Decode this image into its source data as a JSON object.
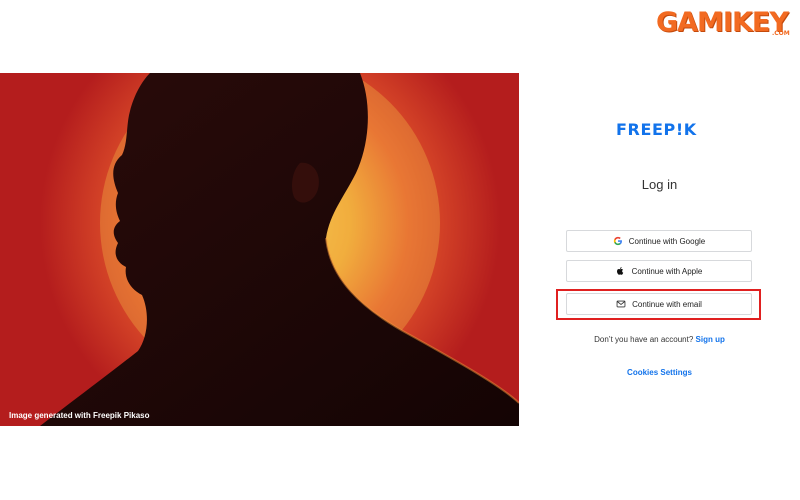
{
  "watermark": {
    "brand": "GAMIKEY",
    "suffix": ".COM"
  },
  "hero": {
    "caption": "Image generated with Freepik Pikaso",
    "colors": {
      "background": "#c0221f",
      "sun_core": "#f5c84a",
      "silhouette": "#1a0707"
    }
  },
  "login": {
    "logo": "FREEP!K",
    "title": "Log in",
    "buttons": {
      "google": {
        "label": "Continue with Google",
        "icon": "google-icon"
      },
      "apple": {
        "label": "Continue with Apple",
        "icon": "apple-icon"
      },
      "email": {
        "label": "Continue with email",
        "icon": "mail-icon"
      }
    },
    "no_account_text": "Don’t you have an account?",
    "signup_link": "Sign up",
    "cookies_link": "Cookies Settings"
  },
  "colors": {
    "accent": "#1273eb",
    "highlight": "#e02020",
    "watermark": "#f26a21"
  }
}
